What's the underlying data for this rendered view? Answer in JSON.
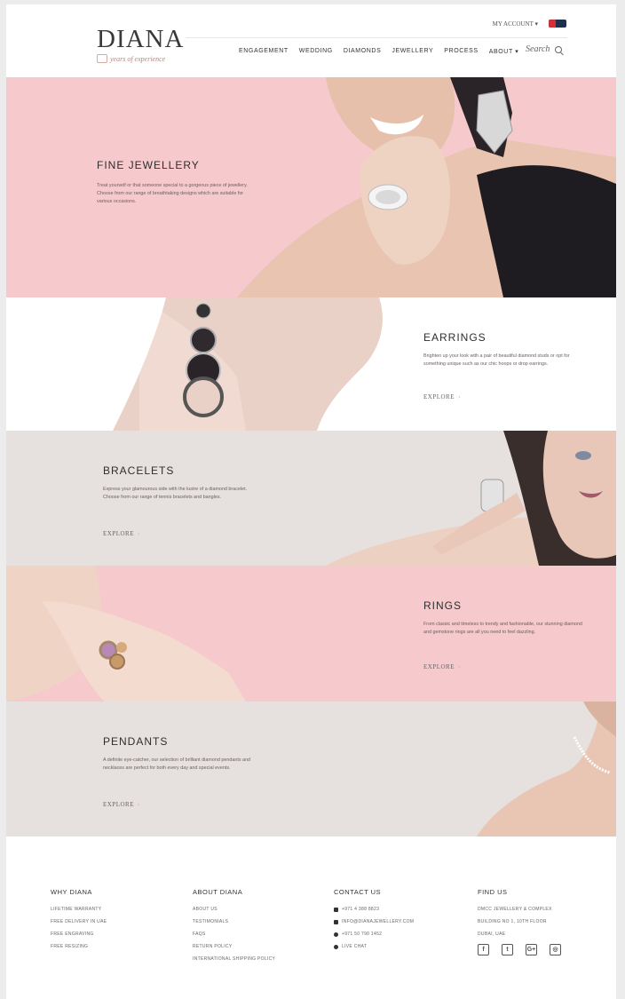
{
  "brand": {
    "name": "DIANA",
    "tagline": "years of experience"
  },
  "topbar": {
    "account": "MY ACCOUNT ▾"
  },
  "nav": [
    "ENGAGEMENT",
    "WEDDING",
    "DIAMONDS",
    "JEWELLERY",
    "PROCESS",
    "ABOUT ▾"
  ],
  "search": {
    "label": "Search"
  },
  "sections": {
    "fine": {
      "title": "FINE JEWELLERY",
      "desc": "Treat yourself or that someone special to a gorgeous piece of jewellery. Choose from our range of breathtaking designs which are suitable for various occasions."
    },
    "earrings": {
      "title": "EARRINGS",
      "desc": "Brighten up your look with a pair of beautiful diamond studs or opt for something unique such as our chic hoops or drop earrings.",
      "cta": "EXPLORE"
    },
    "bracelets": {
      "title": "BRACELETS",
      "desc": "Express your glamourous side with the lustre of a diamond bracelet. Choose from our range of tennis bracelets and bangles.",
      "cta": "EXPLORE"
    },
    "rings": {
      "title": "RINGS",
      "desc": "From classic and timeless to trendy and fashionable, our stunning diamond and gemstone rings are all you need to feel dazzling.",
      "cta": "EXPLORE"
    },
    "pendants": {
      "title": "PENDANTS",
      "desc": "A definite eye-catcher, our selection of brilliant diamond pendants and necklaces are perfect for both every day and special events.",
      "cta": "EXPLORE"
    }
  },
  "footer": {
    "why": {
      "title": "WHY DIANA",
      "items": [
        "LIFETIME WARRANTY",
        "FREE DELIVERY IN UAE",
        "FREE ENGRAVING",
        "FREE RESIZING"
      ]
    },
    "about": {
      "title": "ABOUT DIANA",
      "items": [
        "ABOUT US",
        "TESTIMONIALS",
        "FAQS",
        "RETURN POLICY",
        "INTERNATIONAL SHIPPING POLICY"
      ]
    },
    "contact": {
      "title": "CONTACT US",
      "items": [
        "+971 4 388 8823",
        "INFO@DIANAJEWELLERY.COM",
        "+971 50 790 1452",
        "LIVE CHAT"
      ]
    },
    "find": {
      "title": "FIND US",
      "items": [
        "DMCC JEWELLERY & COMPLEX",
        "BUILDING NO 1, 10TH FLOOR",
        "DUBAI, UAE"
      ],
      "social": [
        "f",
        "t",
        "G+",
        "◎"
      ]
    }
  },
  "colors": {
    "pink": "#f6c9cc",
    "grey": "#e6e1de",
    "accent": "#d7a9a0"
  }
}
